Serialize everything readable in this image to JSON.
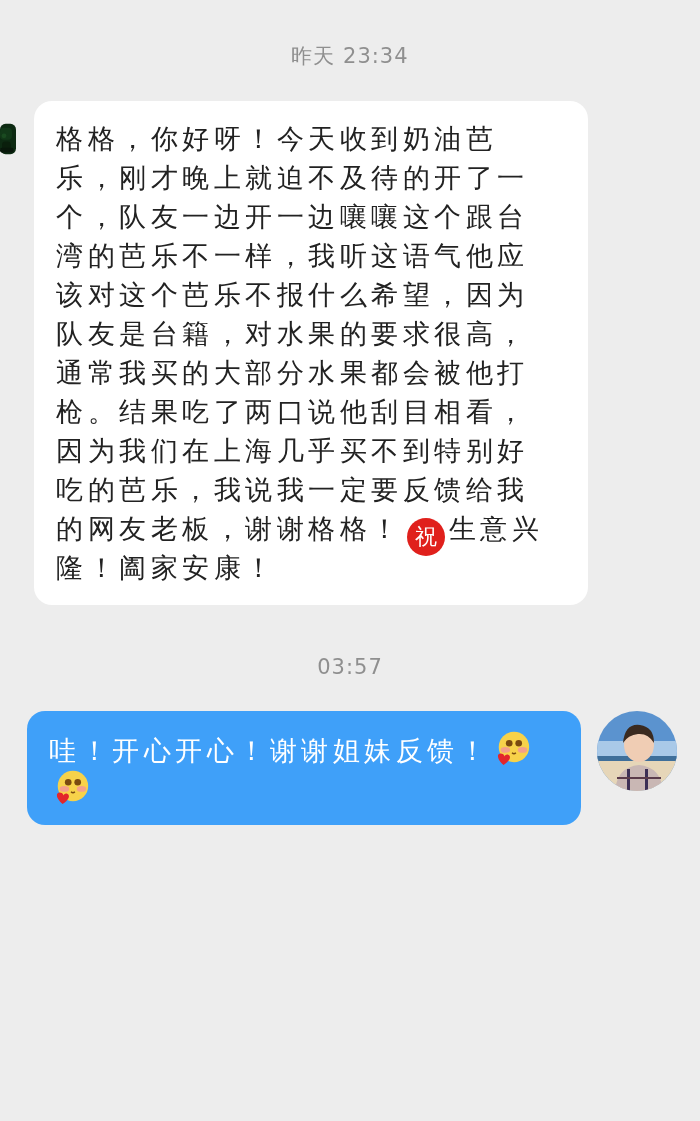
{
  "messages": [
    {
      "kind": "timestamp",
      "text": "昨天 23:34"
    },
    {
      "kind": "received",
      "avatar": {
        "kind": "picture"
      },
      "lines": [
        {
          "segments": [
            {
              "kind": "text",
              "text": "格格，你好呀！今天收到奶油芭"
            }
          ]
        },
        {
          "segments": [
            {
              "kind": "text",
              "text": "乐，刚才晚上就迫不及待的开了一"
            }
          ]
        },
        {
          "segments": [
            {
              "kind": "text",
              "text": "个，队友一边开一边嚷嚷这个跟台"
            }
          ]
        },
        {
          "segments": [
            {
              "kind": "text",
              "text": "湾的芭乐不一样，我听这语气他应"
            }
          ]
        },
        {
          "segments": [
            {
              "kind": "text",
              "text": "该对这个芭乐不报什么希望，因为"
            }
          ]
        },
        {
          "segments": [
            {
              "kind": "text",
              "text": "队友是台籍，对水果的要求很高，"
            }
          ]
        },
        {
          "segments": [
            {
              "kind": "text",
              "text": "通常我买的大部分水果都会被他打"
            }
          ]
        },
        {
          "segments": [
            {
              "kind": "text",
              "text": "枪。结果吃了两口说他刮目相看，"
            }
          ]
        },
        {
          "segments": [
            {
              "kind": "text",
              "text": "因为我们在上海几乎买不到特别好"
            }
          ]
        },
        {
          "segments": [
            {
              "kind": "text",
              "text": "吃的芭乐，我说我一定要反馈给我"
            }
          ]
        },
        {
          "segments": [
            {
              "kind": "text",
              "text": "的网友老板，谢谢格格！"
            },
            {
              "kind": "badge",
              "text": "祝"
            },
            {
              "kind": "text",
              "text": "生意兴"
            }
          ]
        },
        {
          "segments": [
            {
              "kind": "text",
              "text": "隆！阖家安康！"
            }
          ]
        }
      ]
    },
    {
      "kind": "timestamp",
      "text": "03:57"
    },
    {
      "kind": "sent",
      "avatar": {
        "kind": "picture"
      },
      "lines": [
        {
          "segments": [
            {
              "kind": "text",
              "text": "哇！开心开心！谢谢姐妹反馈！"
            },
            {
              "kind": "emoji"
            }
          ]
        },
        {
          "segments": [
            {
              "kind": "emoji"
            }
          ]
        }
      ]
    }
  ]
}
